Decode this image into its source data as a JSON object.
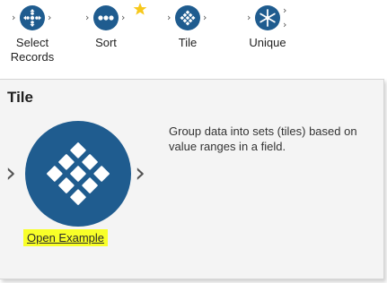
{
  "palette": {
    "tools": [
      {
        "label": "Select\nRecords",
        "icon": "select-records-icon",
        "color": "#1f5c8f"
      },
      {
        "label": "Sort",
        "icon": "sort-icon",
        "color": "#1f5c8f",
        "favorite": true
      },
      {
        "label": "Tile",
        "icon": "tile-icon",
        "color": "#1f5c8f"
      },
      {
        "label": "Unique",
        "icon": "unique-icon",
        "color": "#1f5c8f"
      }
    ],
    "star_color": "#f7c81b"
  },
  "detail": {
    "title": "Tile",
    "description": "Group data into sets (tiles) based on value ranges in a field.",
    "open_example_label": "Open Example",
    "highlight_color": "#f8ff28",
    "icon": "tile-icon",
    "icon_color": "#1f5c8f"
  }
}
